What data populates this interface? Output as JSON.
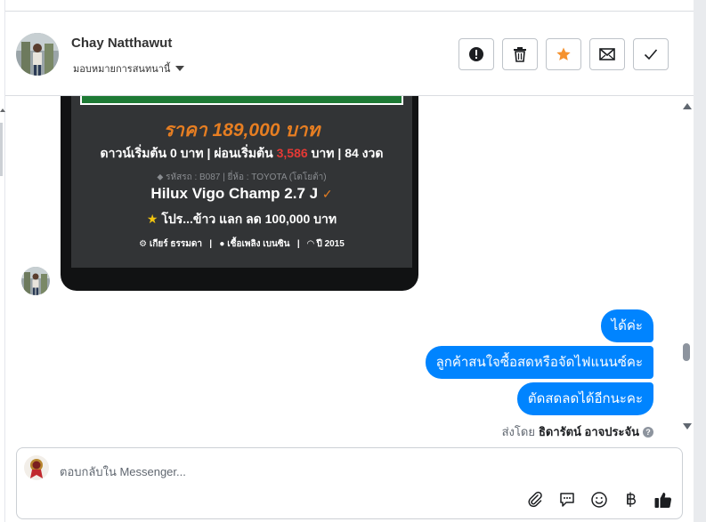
{
  "conversation": {
    "contact_name": "Chay Natthawut",
    "assign_label": "มอบหมายการสนทนานี้"
  },
  "header_actions": [
    {
      "name": "mark-spam-button",
      "icon": "alert-circle-icon"
    },
    {
      "name": "delete-button",
      "icon": "trash-icon"
    },
    {
      "name": "star-button",
      "icon": "star-icon",
      "color": "#f5922f"
    },
    {
      "name": "mark-unread-button",
      "icon": "envelope-icon"
    },
    {
      "name": "mark-done-button",
      "icon": "check-icon"
    }
  ],
  "car_card": {
    "price": "ราคา 189,000 บาท",
    "down_pre": "ดาวน์เริ่มต้น 0 บาท | ผ่อนเริ่มต้น ",
    "installment": "3,586",
    "down_post": " บาท | 84 งวด",
    "meta": "รหัสรถ : B087 | ยี่ห้อ : TOYOTA (โตโยต้า)",
    "model": "Hilux Vigo Champ 2.7 J",
    "promo": "โปร...ข้าว แลก ลด 100,000 บาท",
    "gear": "เกียร์ ธรรมดา",
    "fuel": "เชื้อเพลิง เบนซิน",
    "year": "ปี 2015"
  },
  "messages": [
    {
      "text": "ได้ค่ะ"
    },
    {
      "text": "ลูกค้าสนใจซื้อสดหรือจัดไฟแนนซ์คะ"
    },
    {
      "text": "ตัดสดลดได้อีกนะคะ"
    }
  ],
  "sent_by": {
    "prefix": "ส่งโดย",
    "name": "ธิดารัตน์ อาจประจัน"
  },
  "composer": {
    "placeholder": "ตอบกลับใน Messenger..."
  },
  "composer_tools": [
    "paperclip-icon",
    "saved-reply-icon",
    "emoji-icon",
    "baht-icon",
    "thumbs-up-icon"
  ],
  "colors": {
    "accent": "#0084ff",
    "price_orange": "#e67e22",
    "highlight_red": "#e53935"
  }
}
